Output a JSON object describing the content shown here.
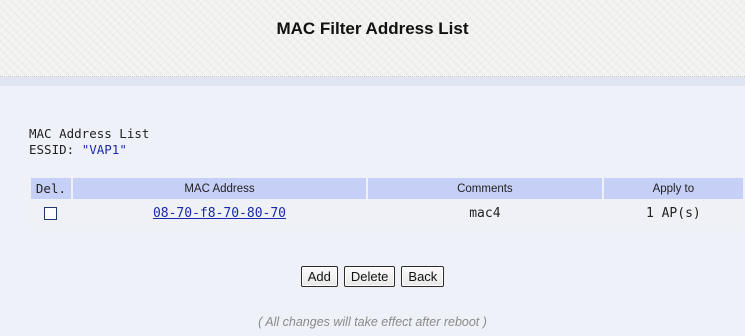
{
  "page": {
    "title": "MAC Filter Address List"
  },
  "list": {
    "title": "MAC Address List",
    "essid_label": "ESSID: ",
    "essid_value": "\"VAP1\""
  },
  "table": {
    "headers": {
      "del": "Del.",
      "mac": "MAC Address",
      "comments": "Comments",
      "apply_to": "Apply to"
    },
    "rows": [
      {
        "checked": false,
        "mac": "08-70-f8-70-80-70",
        "comments": "mac4",
        "apply_to": "1 AP(s)"
      }
    ]
  },
  "buttons": {
    "add": "Add",
    "delete": "Delete",
    "back": "Back"
  },
  "notice": "( All changes will take effect after reboot )"
}
